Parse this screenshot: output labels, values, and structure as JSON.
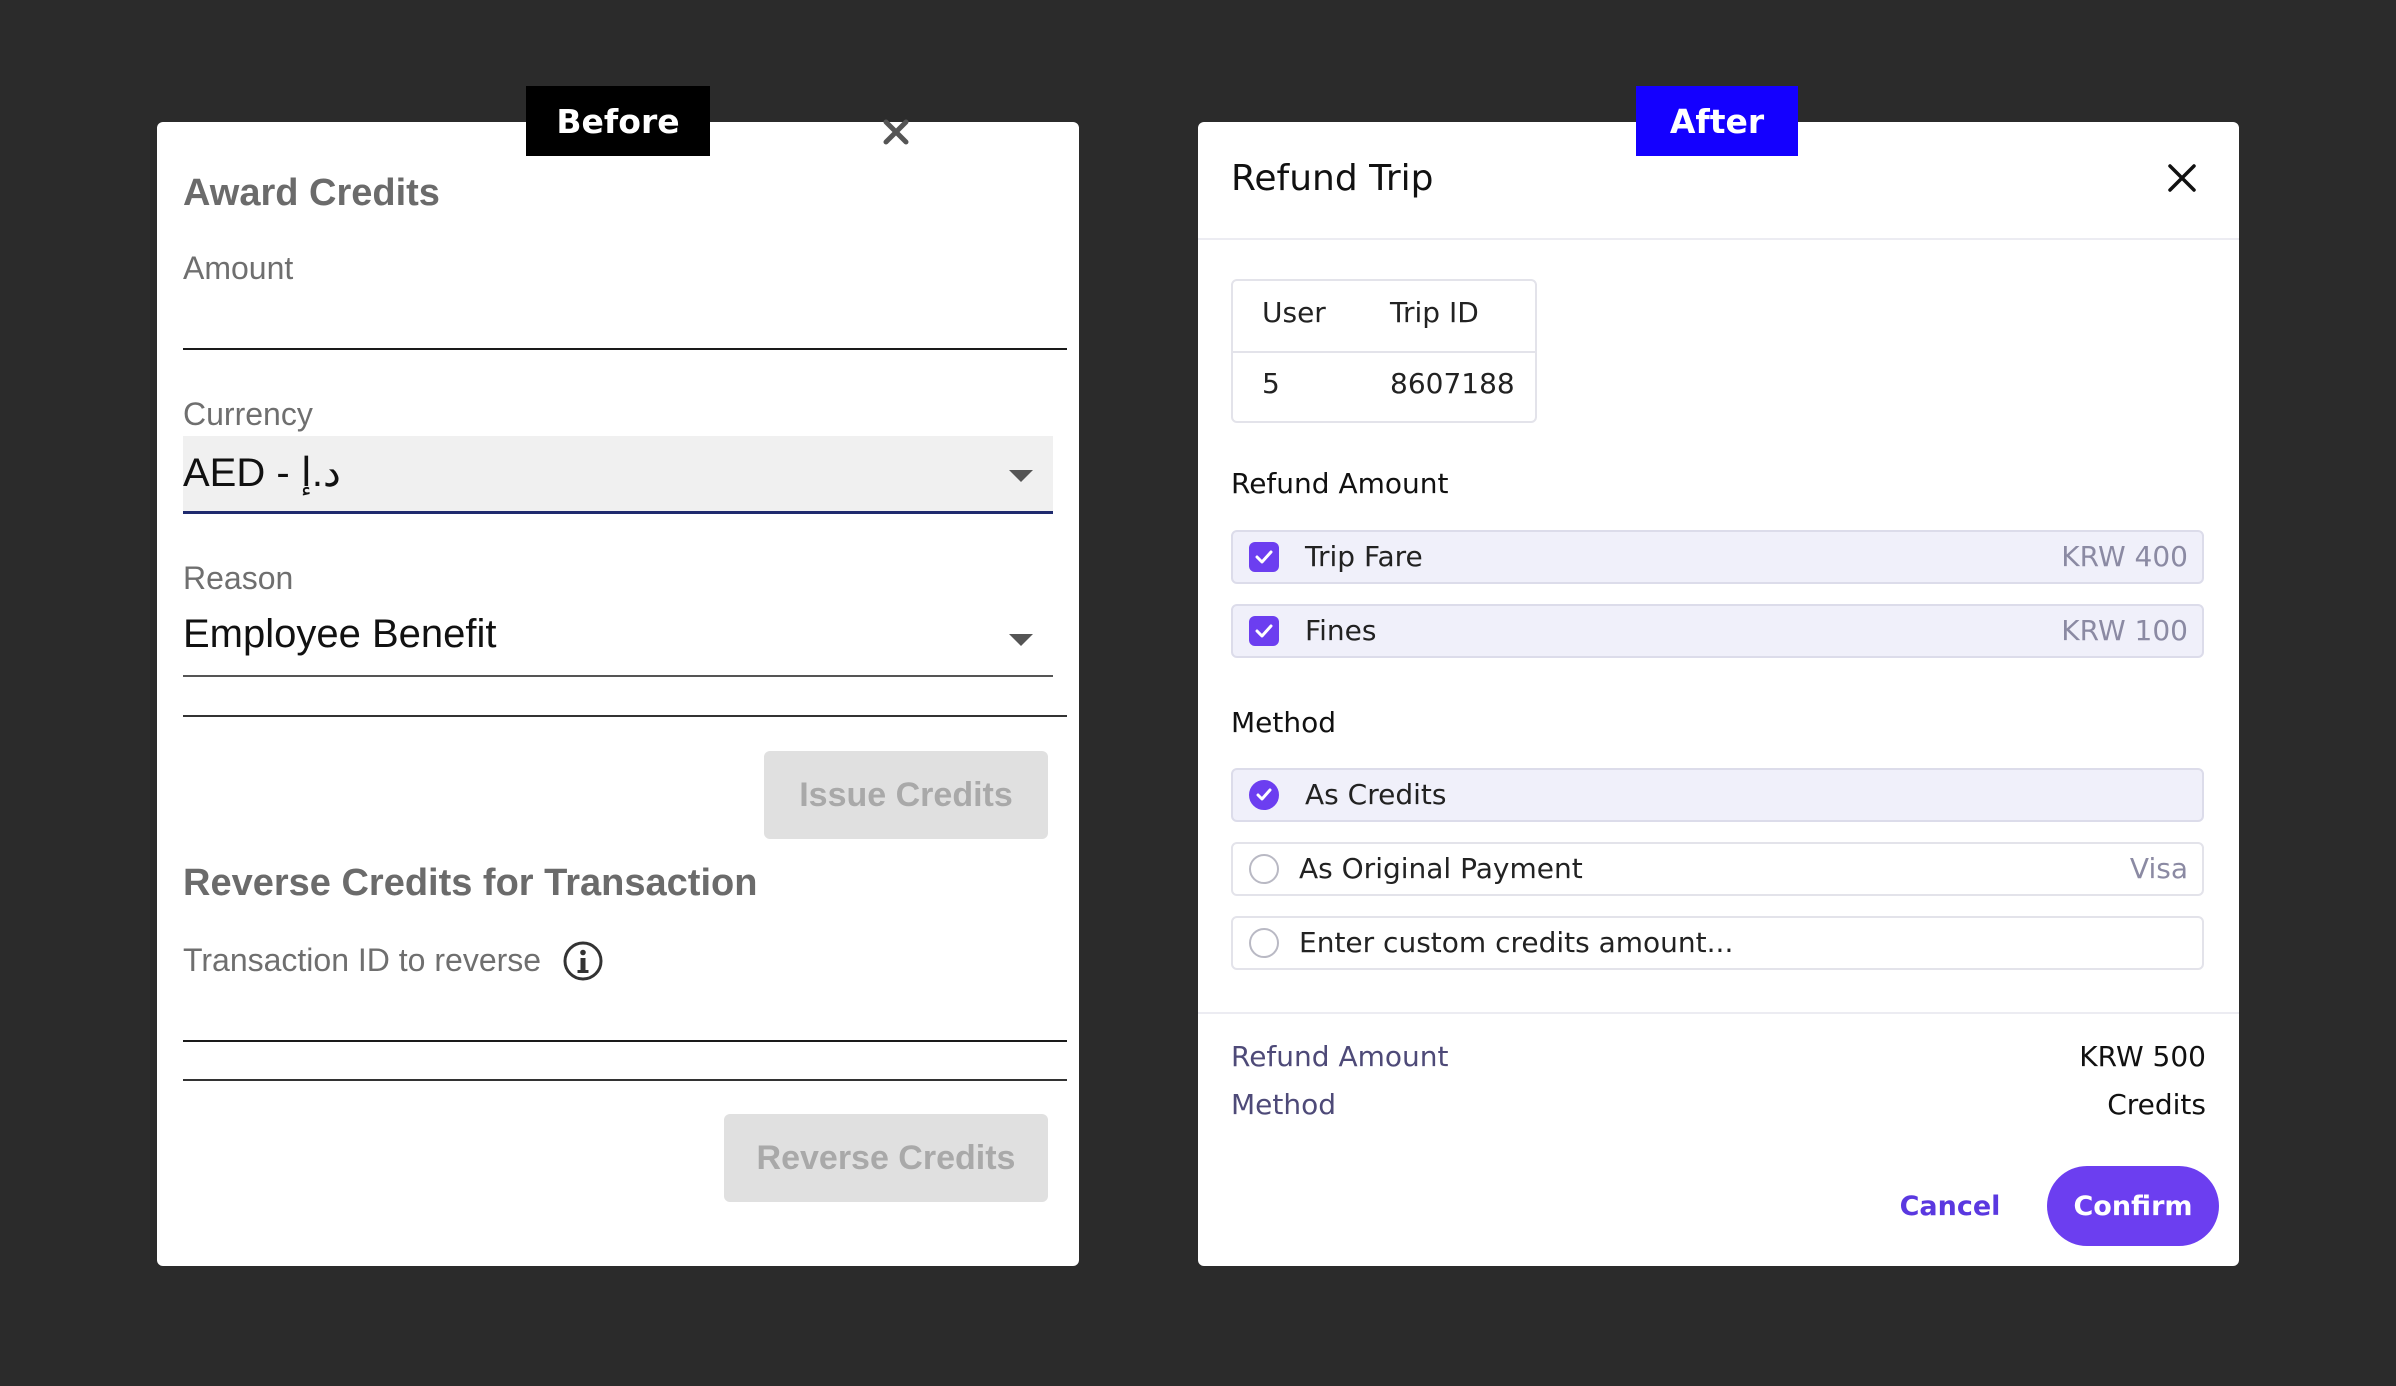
{
  "labels": {
    "before": "Before",
    "after": "After"
  },
  "before": {
    "award_title": "Award Credits",
    "amount_label": "Amount",
    "amount_value": "",
    "currency_label": "Currency",
    "currency_value": "AED - د.إ",
    "reason_label": "Reason",
    "reason_value": "Employee Benefit",
    "issue_button": "Issue Credits",
    "reverse_title": "Reverse Credits for Transaction",
    "txn_label": "Transaction ID to reverse",
    "txn_value": "",
    "reverse_button": "Reverse Credits"
  },
  "after": {
    "title": "Refund Trip",
    "table": {
      "headers": [
        "User",
        "Trip ID"
      ],
      "row": [
        "5",
        "8607188"
      ]
    },
    "refund_amount_heading": "Refund Amount",
    "items": [
      {
        "label": "Trip Fare",
        "amount": "KRW 400",
        "checked": true
      },
      {
        "label": "Fines",
        "amount": "KRW 100",
        "checked": true
      }
    ],
    "method_heading": "Method",
    "methods": [
      {
        "label": "As Credits",
        "note": "",
        "selected": true
      },
      {
        "label": "As Original Payment",
        "note": "Visa",
        "selected": false
      },
      {
        "label": "Enter custom credits amount...",
        "note": "",
        "selected": false
      }
    ],
    "summary": {
      "refund_label": "Refund Amount",
      "refund_value": "KRW 500",
      "method_label": "Method",
      "method_value": "Credits"
    },
    "cancel_button": "Cancel",
    "confirm_button": "Confirm"
  },
  "colors": {
    "accent": "#6c3ef0",
    "after_tag": "#1400ff",
    "background": "#2b2b2b"
  }
}
